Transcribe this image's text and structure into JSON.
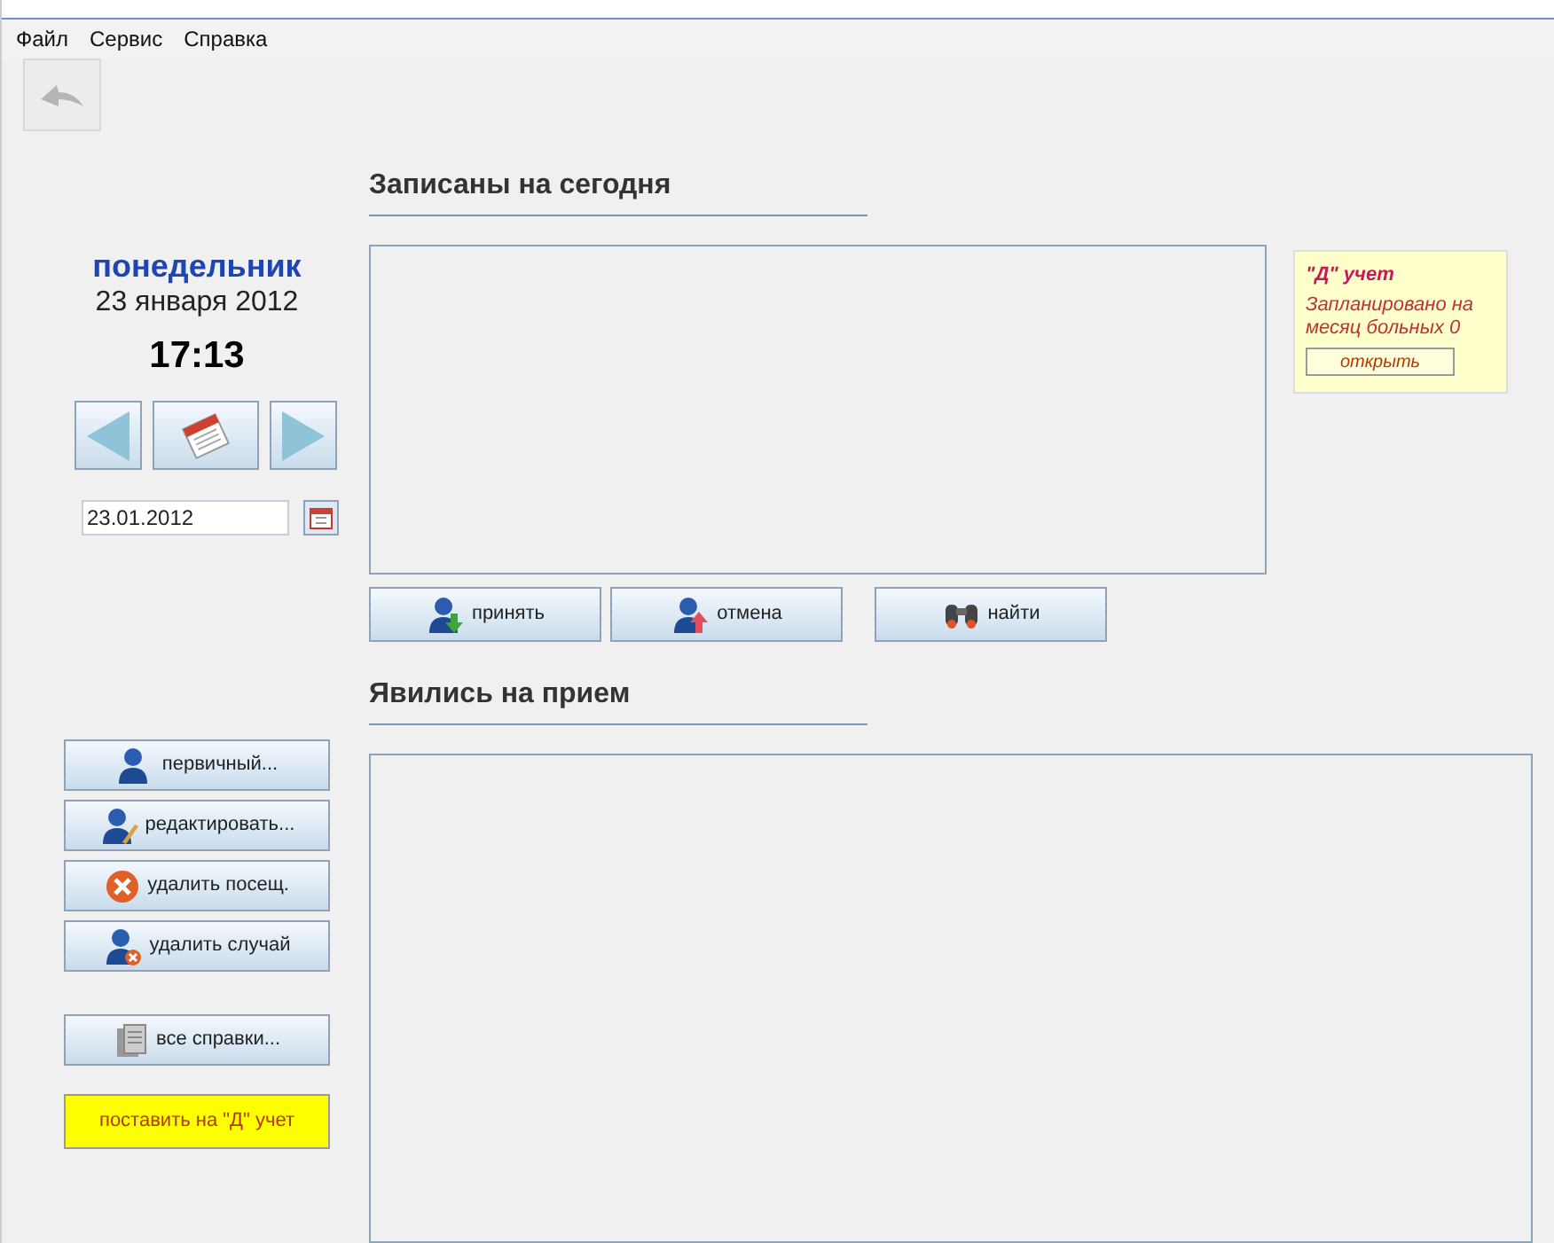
{
  "menu": [
    "Файл",
    "Сервис",
    "Справка"
  ],
  "day": {
    "weekday": "понедельник",
    "date": "23 января 2012",
    "time": "17:13",
    "date_field": "23.01.2012"
  },
  "scheduled": {
    "title": "Записаны на сегодня",
    "buttons": [
      {
        "label": "принять",
        "kind": "accept"
      },
      {
        "label": "отмена",
        "kind": "cancel"
      },
      {
        "label": "найти",
        "kind": "find"
      }
    ]
  },
  "dispensary": {
    "title": "\"Д\" учет",
    "text": "Запланировано на месяц больных 0",
    "button": "открыть"
  },
  "arrived": {
    "title": "Явились на прием"
  },
  "actions": [
    {
      "label": "первичный...",
      "kind": "person"
    },
    {
      "label": "редактировать...",
      "kind": "edit"
    },
    {
      "label": "удалить посещ.",
      "kind": "delete"
    },
    {
      "label": "удалить случай",
      "kind": "delete-case"
    },
    {
      "label": "все справки...",
      "kind": "docs"
    },
    {
      "label": "поставить на \"Д\" учет",
      "kind": "highlight"
    }
  ]
}
